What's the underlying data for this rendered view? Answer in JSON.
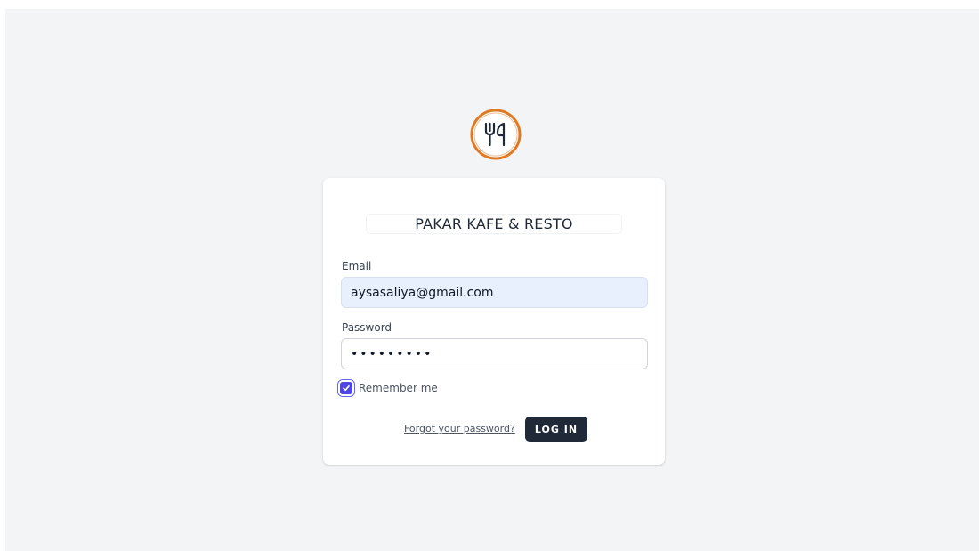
{
  "brand": {
    "name": "PAKAR KAFE & RESTO",
    "logo_icon": "fork-knife-icon",
    "logo_color": "#e07a22"
  },
  "form": {
    "email_label": "Email",
    "email_value": "aysasaliya@gmail.com",
    "password_label": "Password",
    "password_value": "•••••••••",
    "remember_label": "Remember me",
    "remember_checked": true,
    "forgot_link": "Forgot your password?",
    "submit_label": "LOG IN"
  },
  "colors": {
    "background": "#f3f4f6",
    "button": "#1f2937",
    "checkbox": "#4f46e5",
    "email_autofill": "#e8f0fe"
  }
}
